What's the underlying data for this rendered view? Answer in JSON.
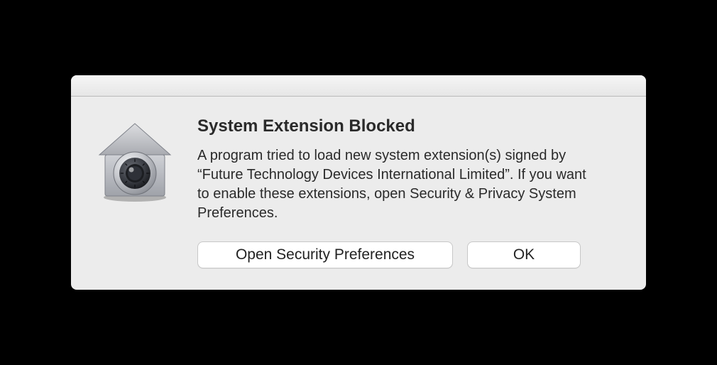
{
  "icon": "security-house-vault-icon",
  "dialog": {
    "title": "System Extension Blocked",
    "body": "A program tried to load new system extension(s) signed by “Future Technology Devices International Limited”.  If you want to enable these extensions, open Security & Privacy System Preferences.",
    "buttons": {
      "open_prefs": "Open Security Preferences",
      "ok": "OK"
    }
  }
}
